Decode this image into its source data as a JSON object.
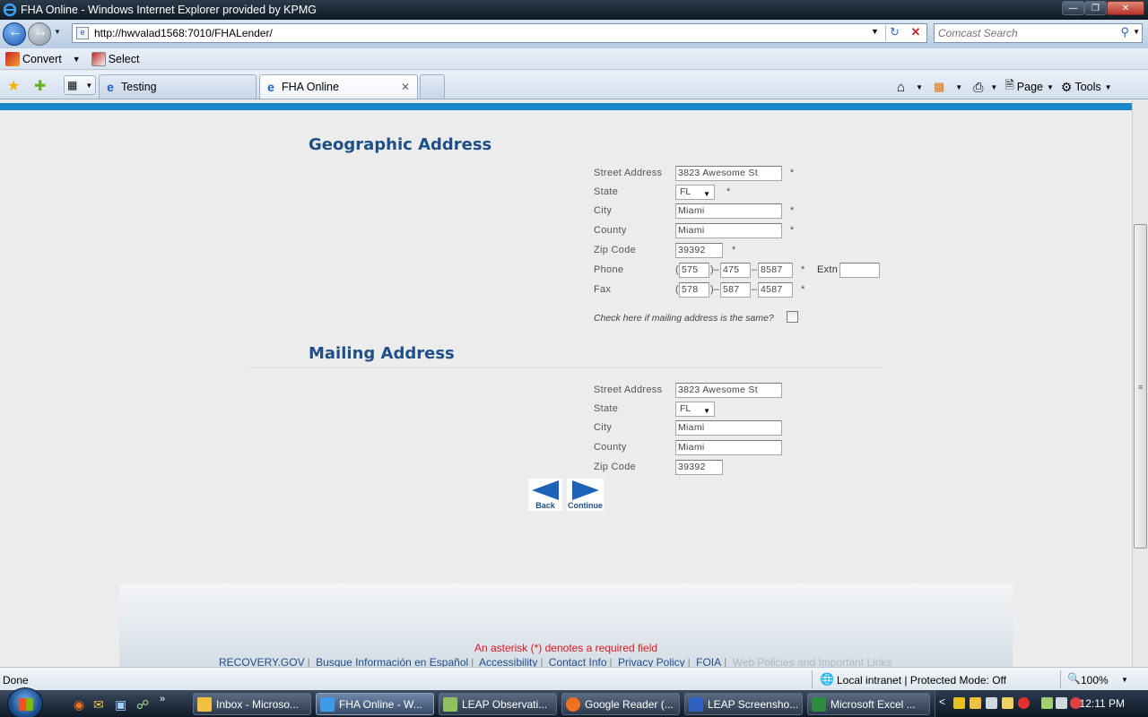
{
  "browser": {
    "title": "FHA Online - Windows Internet Explorer provided by KPMG",
    "url": "http://hwvalad1568:7010/FHALender/",
    "search_placeholder": "Comcast Search",
    "convert_label": "Convert",
    "select_label": "Select",
    "tabs": [
      {
        "label": "Testing"
      },
      {
        "label": "FHA Online"
      }
    ],
    "cmd": {
      "page": "Page",
      "tools": "Tools"
    },
    "status": {
      "done": "Done",
      "zone": "Local intranet | Protected Mode: Off",
      "zoom": "100%"
    }
  },
  "geographic": {
    "title": "Geographic Address",
    "street_label": "Street Address",
    "street_value": "3823 Awesome St",
    "state_label": "State",
    "state_value": "FL",
    "city_label": "City",
    "city_value": "Miami",
    "county_label": "County",
    "county_value": "Miami",
    "zip_label": "Zip Code",
    "zip_value": "39392",
    "phone_label": "Phone",
    "phone": {
      "area": "575",
      "prefix": "475",
      "line": "8587"
    },
    "extn_label": "Extn",
    "fax_label": "Fax",
    "fax": {
      "area": "578",
      "prefix": "587",
      "line": "4587"
    },
    "same_label": "Check here if mailing address is the same?",
    "required_mark": "*"
  },
  "mailing": {
    "title": "Mailing Address",
    "street_label": "Street Address",
    "street_value": "3823 Awesome St",
    "state_label": "State",
    "state_value": "FL",
    "city_label": "City",
    "city_value": "Miami",
    "county_label": "County",
    "county_value": "Miami",
    "zip_label": "Zip Code",
    "zip_value": "39392"
  },
  "nav": {
    "back": "Back",
    "continue": "Continue"
  },
  "footer": {
    "required_note": "An asterisk (*) denotes a required field",
    "links": [
      "RECOVERY.GOV",
      "Busque Información en Español",
      "Accessibility",
      "Contact Info",
      "Privacy Policy",
      "FOIA"
    ],
    "dim_link": "Web Policies and Important Links"
  },
  "taskbar": {
    "items": [
      {
        "label": "Inbox - Microso..."
      },
      {
        "label": "FHA Online - W..."
      },
      {
        "label": "LEAP Observati..."
      },
      {
        "label": "Google Reader (..."
      },
      {
        "label": "LEAP Screensho..."
      },
      {
        "label": "Microsoft Excel ..."
      }
    ],
    "clock": "12:11 PM"
  },
  "colors": {
    "heading": "#1f4f87",
    "accent_bar": "#1a88c8",
    "required_note": "#e0161e"
  }
}
